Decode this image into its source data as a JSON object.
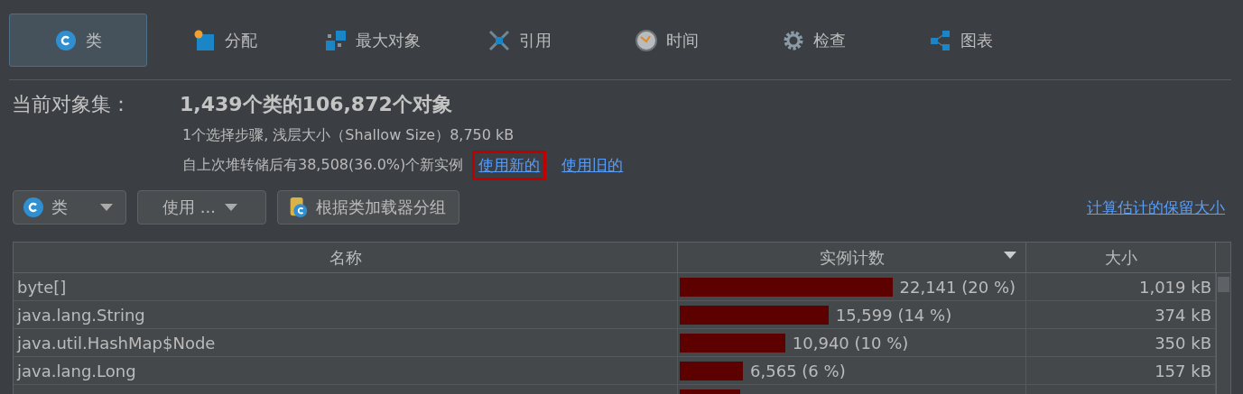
{
  "tabs": [
    {
      "label": "类",
      "kind": "class",
      "selected": true
    },
    {
      "label": "分配",
      "kind": "alloc",
      "selected": false
    },
    {
      "label": "最大对象",
      "kind": "biggest",
      "selected": false
    },
    {
      "label": "引用",
      "kind": "refs",
      "selected": false
    },
    {
      "label": "时间",
      "kind": "time",
      "selected": false
    },
    {
      "label": "检查",
      "kind": "inspect",
      "selected": false
    },
    {
      "label": "图表",
      "kind": "chart",
      "selected": false
    }
  ],
  "summary": {
    "label": "当前对象集：",
    "headline": "1,439个类的106,872个对象",
    "line_1": "1个选择步骤, 浅层大小（Shallow Size）8,750 kB",
    "line_2": "自上次堆转储后有38,508(36.0%)个新实例",
    "links": [
      {
        "label": "使用新的",
        "highlighted": true
      },
      {
        "label": "使用旧的",
        "highlighted": false
      }
    ]
  },
  "toolbar": {
    "view_dropdown": "类",
    "use_dropdown": "使用 ...",
    "group_button": "根据类加载器分组",
    "compute_link": "计算估计的保留大小"
  },
  "table": {
    "columns": [
      {
        "label": "名称",
        "sorted": false
      },
      {
        "label": "实例计数",
        "sorted": true
      },
      {
        "label": "大小",
        "sorted": false
      }
    ],
    "rows": [
      {
        "name": "byte[]",
        "level": 0.615,
        "count": "22,141 (20 %)",
        "size": "1,019 kB"
      },
      {
        "name": "java.lang.String",
        "level": 0.43,
        "count": "15,599 (14 %)",
        "size": "374 kB"
      },
      {
        "name": "java.util.HashMap$Node",
        "level": 0.305,
        "count": "10,940 (10 %)",
        "size": "350 kB"
      },
      {
        "name": "java.lang.Long",
        "level": 0.183,
        "count": "6,565 (6 %)",
        "size": "157 kB"
      },
      {
        "level": 0.176
      }
    ]
  }
}
